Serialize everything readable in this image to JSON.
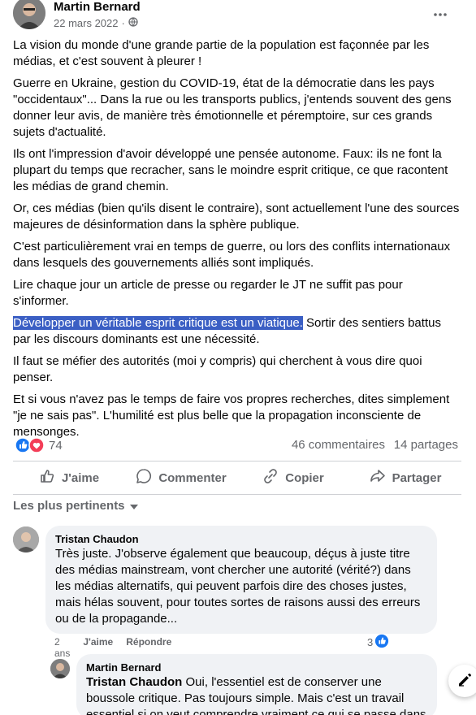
{
  "post": {
    "author": "Martin Bernard",
    "date": "22 mars 2022",
    "paragraphs": {
      "p1": "La vision du monde d'une grande partie de la population est façonnée par les médias, et c'est souvent à pleurer !",
      "p2": "Guerre en Ukraine, gestion du COVID-19, état de la démocratie dans les pays \"occidentaux\"... Dans la rue ou les transports publics, j'entends souvent des gens donner leur avis, de manière très émotionnelle et péremptoire, sur ces grands sujets d'actualité.",
      "p3": "Ils ont l'impression d'avoir développé une pensée autonome. Faux: ils ne font la plupart du temps que recracher, sans le moindre esprit critique, ce que racontent les médias de grand chemin.",
      "p4": "Or, ces médias (bien qu'ils disent le contraire), sont actuellement l'une des sources majeures de désinformation dans la sphère publique.",
      "p5": "C'est particulièrement vrai en temps de guerre, ou lors des conflits internationaux dans lesquels des gouvernements alliés sont impliqués.",
      "p6": "Lire chaque jour un article de presse ou regarder le JT ne suffit pas pour s'informer.",
      "p7_highlight": "Développer un véritable esprit critique est un viatique.",
      "p7_rest": " Sortir des sentiers battus par les discours dominants est une nécessité.",
      "p8": "Il faut se méfier des autorités (moi y compris) qui cherchent à vous dire quoi penser.",
      "p9": "Et si vous n'avez pas le temps de faire vos propres recherches, dites simplement \"je ne sais pas\". L'humilité est plus belle que la propagation inconsciente de mensonges."
    },
    "reaction_count": "74",
    "comment_count": "46 commentaires",
    "share_count": "14 partages"
  },
  "actions": {
    "like": "J'aime",
    "comment": "Commenter",
    "copy": "Copier",
    "share": "Partager"
  },
  "sort_label": "Les plus pertinents",
  "comments": [
    {
      "author": "Tristan Chaudon",
      "text": "Très juste. J'observe également que beaucoup, déçus à juste titre des médias mainstream, vont chercher une autorité (vérité?) dans les médias alternatifs, qui peuvent parfois dire des choses justes, mais hélas souvent, pour toutes sortes de raisons aussi des erreurs ou de la propagande...",
      "age": "2 ans",
      "like": "J'aime",
      "reply": "Répondre",
      "reactions": "3"
    },
    {
      "author": "Martin Bernard",
      "mention": "Tristan Chaudon",
      "text": " Oui, l'essentiel est de conserver une boussole critique. Pas toujours simple. Mais c'est un travail essentiel si on veut comprendre vraiment ce qui se passe dans le monde. Il"
    }
  ],
  "colors": {
    "highlight": "#3b5fc4",
    "like_blue": "#1877f2",
    "love_red": "#f33e58",
    "muted_text": "#65676b",
    "bubble": "#f0f2f5"
  },
  "icons": [
    "globe-icon",
    "more-options-icon",
    "like-reaction-icon",
    "love-reaction-icon",
    "thumbs-up-icon",
    "comment-icon",
    "copy-icon",
    "share-icon",
    "caret-down-icon",
    "edit-icon"
  ]
}
